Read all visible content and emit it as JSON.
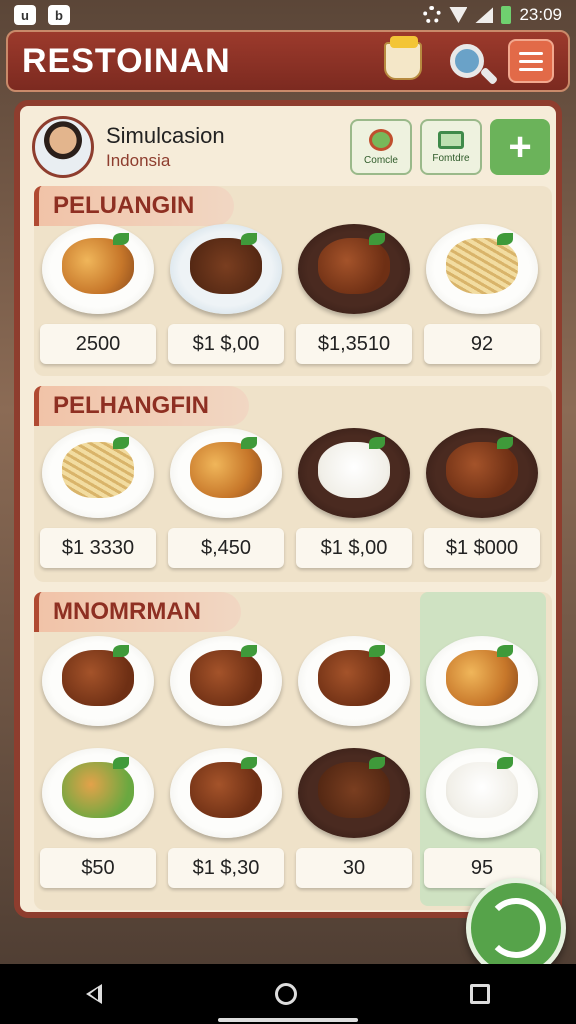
{
  "status_bar": {
    "left_icons": [
      "u",
      "b"
    ],
    "time": "23:09"
  },
  "header": {
    "title": "RESTOINAN",
    "icons": [
      "cup-icon",
      "search-icon",
      "menu-icon"
    ]
  },
  "profile": {
    "name": "Simulcasion",
    "subtitle": "Indonsia",
    "actions": [
      {
        "label": "Comcle",
        "icon": "target-icon"
      },
      {
        "label": "Fomtdre",
        "icon": "tray-icon"
      }
    ],
    "add_label": "+"
  },
  "sections": [
    {
      "title": "PELUANGIN",
      "items": [
        {
          "price": "2500",
          "food": "fried"
        },
        {
          "price": "$1 $,00",
          "food": "stew"
        },
        {
          "price": "$1,3510",
          "food": "meat"
        },
        {
          "price": "92",
          "food": "noodle"
        }
      ]
    },
    {
      "title": "PELHANGFIN",
      "items": [
        {
          "price": "$1 3330",
          "food": "noodle"
        },
        {
          "price": "$,450",
          "food": "fried"
        },
        {
          "price": "$1 $,00",
          "food": "rice"
        },
        {
          "price": "$1 $000",
          "food": "meat"
        }
      ]
    },
    {
      "title": "MNOMRMAN",
      "items": [
        {
          "price": "",
          "food": "meat"
        },
        {
          "price": "",
          "food": "meat"
        },
        {
          "price": "",
          "food": "meat"
        },
        {
          "price": "",
          "food": "fried"
        },
        {
          "price": "$50",
          "food": "greens"
        },
        {
          "price": "$1 $,30",
          "food": "meat"
        },
        {
          "price": "30",
          "food": "stew"
        },
        {
          "price": "95",
          "food": "rice"
        }
      ]
    }
  ],
  "colors": {
    "brand": "#8e3d2e",
    "accent_green": "#6bb35a",
    "panel_bg": "#f6ecd9"
  }
}
